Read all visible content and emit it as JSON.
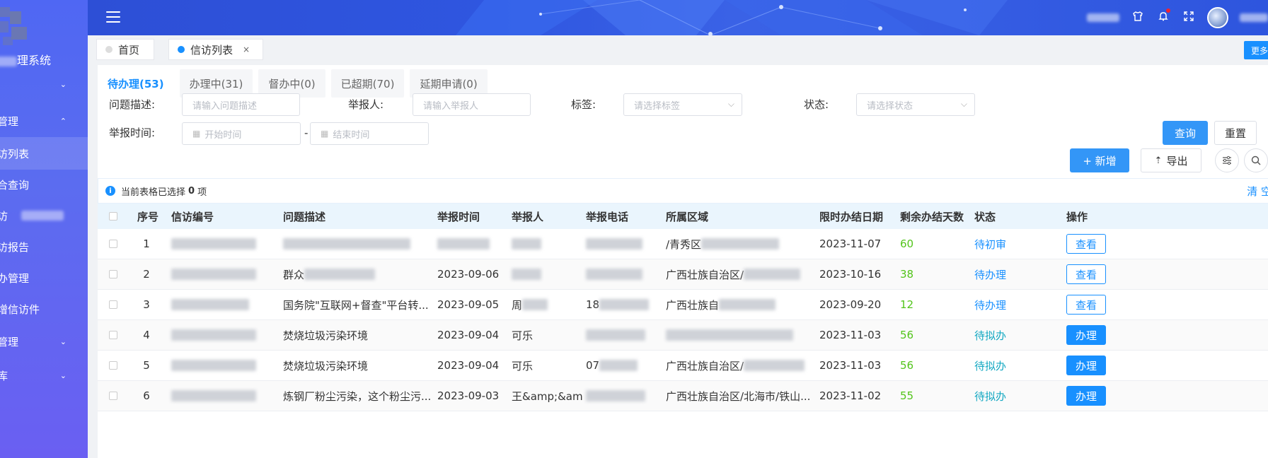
{
  "sidebar": {
    "system_title": "理系统",
    "items": [
      {
        "label": "",
        "chevron": "⌄"
      },
      {
        "label": "管理",
        "chevron": "⌃"
      },
      {
        "label": "访列表",
        "chevron": ""
      },
      {
        "label": "合查询",
        "chevron": ""
      },
      {
        "label": "访",
        "chevron": ""
      },
      {
        "label": "访报告",
        "chevron": ""
      },
      {
        "label": "办管理",
        "chevron": ""
      },
      {
        "label": "增信访件",
        "chevron": ""
      },
      {
        "label": "管理",
        "chevron": "⌄"
      },
      {
        "label": "库",
        "chevron": "⌄"
      }
    ]
  },
  "header": {
    "icons": [
      "menu-icon",
      "shirt-icon",
      "bell-icon",
      "fullscreen-icon"
    ]
  },
  "tagbar": {
    "tags": [
      {
        "label": "首页",
        "active": false
      },
      {
        "label": "信访列表",
        "active": true,
        "close": "×"
      }
    ],
    "more_label": "更多"
  },
  "tabs": [
    {
      "label": "待办理(53)",
      "active": true
    },
    {
      "label": "办理中(31)",
      "active": false
    },
    {
      "label": "督办中(0)",
      "active": false
    },
    {
      "label": "已超期(70)",
      "active": false
    },
    {
      "label": "延期申请(0)",
      "active": false
    }
  ],
  "filters": {
    "desc_label": "问题描述:",
    "desc_placeholder": "请输入问题描述",
    "reporter_label": "举报人:",
    "reporter_placeholder": "请输入举报人",
    "tag_label": "标签:",
    "tag_placeholder": "请选择标签",
    "status_label": "状态:",
    "status_placeholder": "请选择状态",
    "time_label": "举报时间:",
    "start_placeholder": "开始时间",
    "end_placeholder": "结束时间",
    "range_sep": "-",
    "query_btn": "查询",
    "reset_btn": "重置"
  },
  "toolbar": {
    "add_btn": "+ 新增",
    "export_btn": "导出"
  },
  "info": {
    "prefix": "当前表格已选择",
    "count": "0",
    "suffix": "项",
    "clear": "清 空"
  },
  "table": {
    "headers": [
      "序号",
      "信访编号",
      "问题描述",
      "举报时间",
      "举报人",
      "举报电话",
      "所属区域",
      "限时办结日期",
      "剩余办结天数",
      "状态",
      "操作"
    ],
    "rows": [
      {
        "no": "1",
        "code": "",
        "desc": "",
        "time": "",
        "reporter": "",
        "phone": "",
        "region": "/青秀区",
        "deadline": "2023-11-07",
        "days": "60",
        "status": "待初审",
        "status_color": "blue",
        "action": "查看",
        "action_style": "outline"
      },
      {
        "no": "2",
        "code": "",
        "desc": "群众",
        "time": "2023-09-06",
        "reporter": "",
        "phone": "",
        "region": "广西壮族自治区/",
        "deadline": "2023-10-16",
        "days": "38",
        "status": "待办理",
        "status_color": "blue",
        "action": "查看",
        "action_style": "outline"
      },
      {
        "no": "3",
        "code": "",
        "desc": "国务院\"互联网+督查\"平台转...",
        "time": "2023-09-05",
        "reporter": "周",
        "phone": "18",
        "region": "广西壮族自",
        "deadline": "2023-09-20",
        "days": "12",
        "status": "待办理",
        "status_color": "blue",
        "action": "查看",
        "action_style": "outline"
      },
      {
        "no": "4",
        "code": "",
        "desc": "焚烧垃圾污染环境",
        "time": "2023-09-04",
        "reporter": "可乐",
        "phone": "",
        "region": "",
        "deadline": "2023-11-03",
        "days": "56",
        "status": "待拟办",
        "status_color": "cyan",
        "action": "办理",
        "action_style": "solid"
      },
      {
        "no": "5",
        "code": "",
        "desc": "焚烧垃圾污染环境",
        "time": "2023-09-04",
        "reporter": "可乐",
        "phone": "07",
        "region": "广西壮族自治区/",
        "deadline": "2023-11-03",
        "days": "56",
        "status": "待拟办",
        "status_color": "cyan",
        "action": "办理",
        "action_style": "solid"
      },
      {
        "no": "6",
        "code": "",
        "desc": "炼钢厂粉尘污染，这个粉尘污...",
        "time": "2023-09-03",
        "reporter": "王&amp;&am",
        "phone": "",
        "region": "广西壮族自治区/北海市/铁山...",
        "deadline": "2023-11-02",
        "days": "55",
        "status": "待拟办",
        "status_color": "cyan",
        "action": "办理",
        "action_style": "solid"
      }
    ]
  }
}
